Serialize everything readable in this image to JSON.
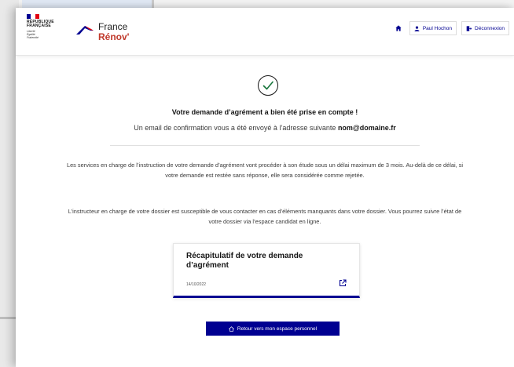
{
  "header": {
    "republique": [
      "RÉPUBLIQUE",
      "FRANÇAISE"
    ],
    "motto": [
      "Liberté",
      "Égalité",
      "Fraternité"
    ],
    "brand_line1": "France",
    "brand_line2": "Rénov'",
    "nav": {
      "home_icon": "home-icon",
      "user_label": "Paul Hochon",
      "logout_label": "Déconnexion"
    }
  },
  "main": {
    "title": "Votre demande d’agrément a bien été prise en compte !",
    "confirm_prefix": "Un email de confirmation vous a été envoyé à l’adresse suivante",
    "email": "nom@domaine.fr",
    "paragraph1": "Les services en charge de l’instruction de votre demande d’agrément vont procéder à son étude sous un délai maximum de 3 mois. Au-delà de ce délai, si votre demande est restée sans réponse, elle sera considérée comme rejetée.",
    "paragraph2": "L’instructeur en charge de votre dossier est susceptible de vous contacter en cas d’éléments manquants dans votre dossier. Vous pourrez suivre l’état de votre dossier via l’espace candidat en ligne.",
    "card": {
      "title": "Récapitulatif de votre demande d’agrément",
      "date": "14/10/2022"
    },
    "back_button": "Retour vers mon espace personnel"
  },
  "colors": {
    "primary": "#000091",
    "success": "#18753c",
    "flag_blue": "#000091",
    "flag_red": "#e1000f"
  }
}
